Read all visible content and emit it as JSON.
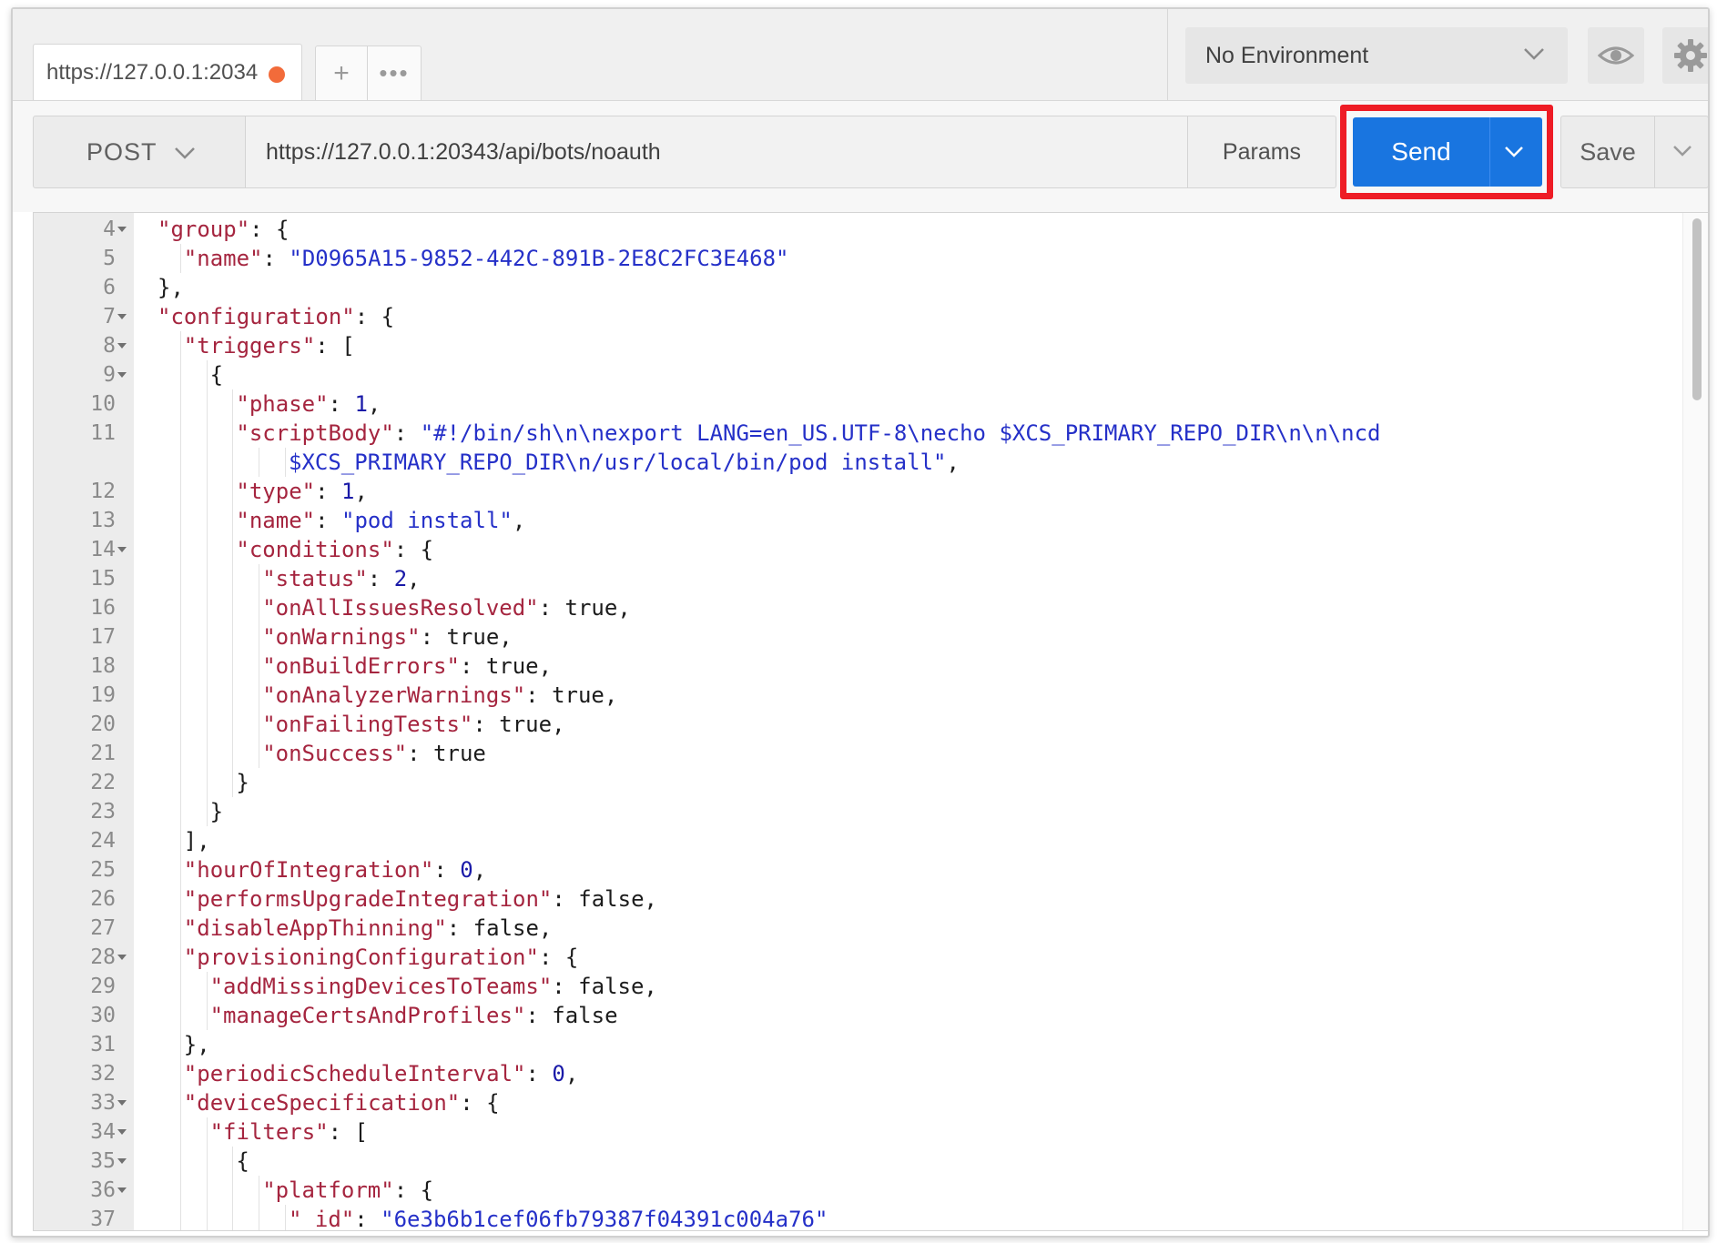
{
  "tabs": [
    {
      "label": "https://127.0.0.1:2034",
      "unsaved": true
    }
  ],
  "tab_actions": {
    "add_icon": "plus-icon",
    "more_icon": "ellipsis-icon"
  },
  "environment": {
    "selected": "No Environment"
  },
  "request": {
    "method": "POST",
    "url": "https://127.0.0.1:20343/api/bots/noauth",
    "params_label": "Params",
    "send_label": "Send",
    "save_label": "Save"
  },
  "colors": {
    "send_button": "#1975e0",
    "highlight_box": "#ee1c25",
    "unsaved_dot": "#f26b3a",
    "json_key": "#a5253f",
    "json_string": "#2530c8"
  },
  "editor": {
    "lines": [
      {
        "num": "4",
        "fold": true,
        "indent": 1,
        "tokens": [
          {
            "t": "k",
            "v": "\"group\""
          },
          {
            "t": "p",
            "v": ": {"
          }
        ]
      },
      {
        "num": "5",
        "fold": false,
        "indent": 2,
        "tokens": [
          {
            "t": "k",
            "v": "\"name\""
          },
          {
            "t": "p",
            "v": ": "
          },
          {
            "t": "s",
            "v": "\"D0965A15-9852-442C-891B-2E8C2FC3E468\""
          }
        ]
      },
      {
        "num": "6",
        "fold": false,
        "indent": 1,
        "tokens": [
          {
            "t": "p",
            "v": "},"
          }
        ]
      },
      {
        "num": "7",
        "fold": true,
        "indent": 1,
        "tokens": [
          {
            "t": "k",
            "v": "\"configuration\""
          },
          {
            "t": "p",
            "v": ": {"
          }
        ]
      },
      {
        "num": "8",
        "fold": true,
        "indent": 2,
        "tokens": [
          {
            "t": "k",
            "v": "\"triggers\""
          },
          {
            "t": "p",
            "v": ": ["
          }
        ]
      },
      {
        "num": "9",
        "fold": true,
        "indent": 3,
        "tokens": [
          {
            "t": "p",
            "v": "{"
          }
        ]
      },
      {
        "num": "10",
        "fold": false,
        "indent": 4,
        "tokens": [
          {
            "t": "k",
            "v": "\"phase\""
          },
          {
            "t": "p",
            "v": ": "
          },
          {
            "t": "n",
            "v": "1"
          },
          {
            "t": "p",
            "v": ","
          }
        ]
      },
      {
        "num": "11",
        "fold": false,
        "indent": 4,
        "tokens": [
          {
            "t": "k",
            "v": "\"scriptBody\""
          },
          {
            "t": "p",
            "v": ": "
          },
          {
            "t": "s",
            "v": "\"#!/bin/sh\\n\\nexport LANG=en_US.UTF-8\\necho $XCS_PRIMARY_REPO_DIR\\n\\n\\ncd"
          }
        ]
      },
      {
        "num": "",
        "fold": false,
        "indent": 6,
        "tokens": [
          {
            "t": "s",
            "v": "$XCS_PRIMARY_REPO_DIR\\n/usr/local/bin/pod install\""
          },
          {
            "t": "p",
            "v": ","
          }
        ]
      },
      {
        "num": "12",
        "fold": false,
        "indent": 4,
        "tokens": [
          {
            "t": "k",
            "v": "\"type\""
          },
          {
            "t": "p",
            "v": ": "
          },
          {
            "t": "n",
            "v": "1"
          },
          {
            "t": "p",
            "v": ","
          }
        ]
      },
      {
        "num": "13",
        "fold": false,
        "indent": 4,
        "tokens": [
          {
            "t": "k",
            "v": "\"name\""
          },
          {
            "t": "p",
            "v": ": "
          },
          {
            "t": "s",
            "v": "\"pod install\""
          },
          {
            "t": "p",
            "v": ","
          }
        ]
      },
      {
        "num": "14",
        "fold": true,
        "indent": 4,
        "tokens": [
          {
            "t": "k",
            "v": "\"conditions\""
          },
          {
            "t": "p",
            "v": ": {"
          }
        ]
      },
      {
        "num": "15",
        "fold": false,
        "indent": 5,
        "tokens": [
          {
            "t": "k",
            "v": "\"status\""
          },
          {
            "t": "p",
            "v": ": "
          },
          {
            "t": "n",
            "v": "2"
          },
          {
            "t": "p",
            "v": ","
          }
        ]
      },
      {
        "num": "16",
        "fold": false,
        "indent": 5,
        "tokens": [
          {
            "t": "k",
            "v": "\"onAllIssuesResolved\""
          },
          {
            "t": "p",
            "v": ": true,"
          }
        ]
      },
      {
        "num": "17",
        "fold": false,
        "indent": 5,
        "tokens": [
          {
            "t": "k",
            "v": "\"onWarnings\""
          },
          {
            "t": "p",
            "v": ": true,"
          }
        ]
      },
      {
        "num": "18",
        "fold": false,
        "indent": 5,
        "tokens": [
          {
            "t": "k",
            "v": "\"onBuildErrors\""
          },
          {
            "t": "p",
            "v": ": true,"
          }
        ]
      },
      {
        "num": "19",
        "fold": false,
        "indent": 5,
        "tokens": [
          {
            "t": "k",
            "v": "\"onAnalyzerWarnings\""
          },
          {
            "t": "p",
            "v": ": true,"
          }
        ]
      },
      {
        "num": "20",
        "fold": false,
        "indent": 5,
        "tokens": [
          {
            "t": "k",
            "v": "\"onFailingTests\""
          },
          {
            "t": "p",
            "v": ": true,"
          }
        ]
      },
      {
        "num": "21",
        "fold": false,
        "indent": 5,
        "tokens": [
          {
            "t": "k",
            "v": "\"onSuccess\""
          },
          {
            "t": "p",
            "v": ": true"
          }
        ]
      },
      {
        "num": "22",
        "fold": false,
        "indent": 4,
        "tokens": [
          {
            "t": "p",
            "v": "}"
          }
        ]
      },
      {
        "num": "23",
        "fold": false,
        "indent": 3,
        "tokens": [
          {
            "t": "p",
            "v": "}"
          }
        ]
      },
      {
        "num": "24",
        "fold": false,
        "indent": 2,
        "tokens": [
          {
            "t": "p",
            "v": "],"
          }
        ]
      },
      {
        "num": "25",
        "fold": false,
        "indent": 2,
        "tokens": [
          {
            "t": "k",
            "v": "\"hourOfIntegration\""
          },
          {
            "t": "p",
            "v": ": "
          },
          {
            "t": "n",
            "v": "0"
          },
          {
            "t": "p",
            "v": ","
          }
        ]
      },
      {
        "num": "26",
        "fold": false,
        "indent": 2,
        "tokens": [
          {
            "t": "k",
            "v": "\"performsUpgradeIntegration\""
          },
          {
            "t": "p",
            "v": ": false,"
          }
        ]
      },
      {
        "num": "27",
        "fold": false,
        "indent": 2,
        "tokens": [
          {
            "t": "k",
            "v": "\"disableAppThinning\""
          },
          {
            "t": "p",
            "v": ": false,"
          }
        ]
      },
      {
        "num": "28",
        "fold": true,
        "indent": 2,
        "tokens": [
          {
            "t": "k",
            "v": "\"provisioningConfiguration\""
          },
          {
            "t": "p",
            "v": ": {"
          }
        ]
      },
      {
        "num": "29",
        "fold": false,
        "indent": 3,
        "tokens": [
          {
            "t": "k",
            "v": "\"addMissingDevicesToTeams\""
          },
          {
            "t": "p",
            "v": ": false,"
          }
        ]
      },
      {
        "num": "30",
        "fold": false,
        "indent": 3,
        "tokens": [
          {
            "t": "k",
            "v": "\"manageCertsAndProfiles\""
          },
          {
            "t": "p",
            "v": ": false"
          }
        ]
      },
      {
        "num": "31",
        "fold": false,
        "indent": 2,
        "tokens": [
          {
            "t": "p",
            "v": "},"
          }
        ]
      },
      {
        "num": "32",
        "fold": false,
        "indent": 2,
        "tokens": [
          {
            "t": "k",
            "v": "\"periodicScheduleInterval\""
          },
          {
            "t": "p",
            "v": ": "
          },
          {
            "t": "n",
            "v": "0"
          },
          {
            "t": "p",
            "v": ","
          }
        ]
      },
      {
        "num": "33",
        "fold": true,
        "indent": 2,
        "tokens": [
          {
            "t": "k",
            "v": "\"deviceSpecification\""
          },
          {
            "t": "p",
            "v": ": {"
          }
        ]
      },
      {
        "num": "34",
        "fold": true,
        "indent": 3,
        "tokens": [
          {
            "t": "k",
            "v": "\"filters\""
          },
          {
            "t": "p",
            "v": ": ["
          }
        ]
      },
      {
        "num": "35",
        "fold": true,
        "indent": 4,
        "tokens": [
          {
            "t": "p",
            "v": "{"
          }
        ]
      },
      {
        "num": "36",
        "fold": true,
        "indent": 5,
        "tokens": [
          {
            "t": "k",
            "v": "\"platform\""
          },
          {
            "t": "p",
            "v": ": {"
          }
        ]
      },
      {
        "num": "37",
        "fold": false,
        "indent": 6,
        "tokens": [
          {
            "t": "k",
            "v": "\"_id\""
          },
          {
            "t": "p",
            "v": ": "
          },
          {
            "t": "s",
            "v": "\"6e3b6b1cef06fb79387f04391c004a76\""
          }
        ]
      }
    ]
  }
}
